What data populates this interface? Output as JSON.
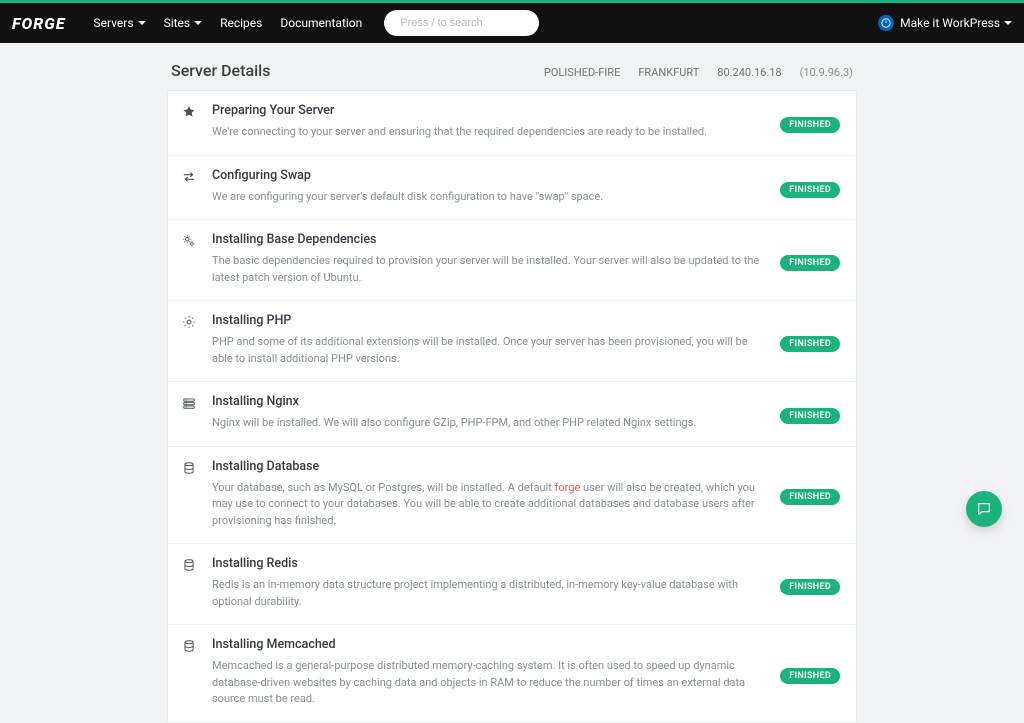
{
  "brand": "FORGE",
  "nav": {
    "servers": "Servers",
    "sites": "Sites",
    "recipes": "Recipes",
    "documentation": "Documentation"
  },
  "search": {
    "placeholder": "Press / to search"
  },
  "user": {
    "label": "Make it WorkPress"
  },
  "page": {
    "title": "Server Details",
    "server_name": "POLISHED-FIRE",
    "region": "FRANKFURT",
    "ip": "80.240.16.18",
    "private_ip": "(10.9.96.3)"
  },
  "status_label": "FINISHED",
  "steps": [
    {
      "icon": "star",
      "title": "Preparing Your Server",
      "desc": "We're connecting to your server and ensuring that the required dependencies are ready to be installed."
    },
    {
      "icon": "swap",
      "title": "Configuring Swap",
      "desc": "We are configuring your server's default disk configuration to have \"swap\" space."
    },
    {
      "icon": "cogs",
      "title": "Installing Base Dependencies",
      "desc": "The basic dependencies required to provision your server will be installed. Your server will also be updated to the latest patch version of Ubuntu."
    },
    {
      "icon": "gear",
      "title": "Installing PHP",
      "desc": "PHP and some of its additional extensions will be installed. Once your server has been provisioned, you will be able to install additional PHP versions."
    },
    {
      "icon": "server",
      "title": "Installing Nginx",
      "desc": "Nginx will be installed. We will also configure GZip, PHP-FPM, and other PHP related Nginx settings."
    },
    {
      "icon": "database",
      "title": "Installing Database",
      "desc_pre": "Your database, such as MySQL or Postgres, will be installed. A default ",
      "desc_accent": "forge",
      "desc_post": " user will also be created, which you may use to connect to your databases. You will be able to create additional databases and database users after provisioning has finished."
    },
    {
      "icon": "database",
      "title": "Installing Redis",
      "desc": "Redis is an in-memory data structure project implementing a distributed, in-memory key-value database with optional durability."
    },
    {
      "icon": "database",
      "title": "Installing Memcached",
      "desc": "Memcached is a general-purpose distributed memory-caching system. It is often used to speed up dynamic database-driven websites by caching data and objects in RAM to reduce the number of times an external data source must be read."
    }
  ]
}
